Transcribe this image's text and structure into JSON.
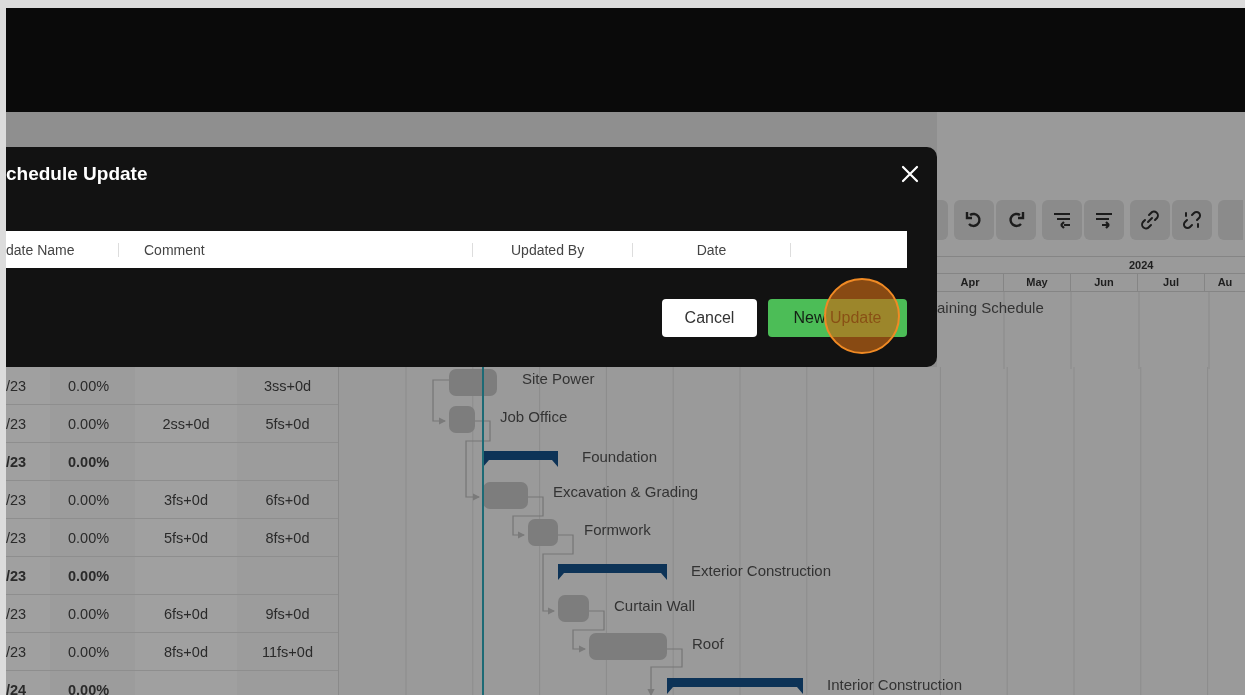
{
  "dialog": {
    "title": "chedule Update",
    "columns": [
      "date Name",
      "Comment",
      "Updated By",
      "Date"
    ],
    "buttons": [
      {
        "label": "Cancel",
        "kind": "secondary"
      },
      {
        "label": "New Update",
        "kind": "primary"
      }
    ]
  },
  "timeline": {
    "year": "2024",
    "months": [
      "Apr",
      "May",
      "Jun",
      "Jul",
      "Au"
    ]
  },
  "gantt": {
    "project_label": "aining Schedule",
    "items": [
      {
        "name": "Site Power",
        "kind": "task"
      },
      {
        "name": "Job Office",
        "kind": "task"
      },
      {
        "name": "Foundation",
        "kind": "summary"
      },
      {
        "name": "Excavation & Grading",
        "kind": "task"
      },
      {
        "name": "Formwork",
        "kind": "task"
      },
      {
        "name": "Exterior Construction",
        "kind": "summary"
      },
      {
        "name": "Curtain Wall",
        "kind": "task"
      },
      {
        "name": "Roof",
        "kind": "task"
      },
      {
        "name": "Interior Construction",
        "kind": "summary"
      }
    ]
  },
  "table": {
    "rows": [
      {
        "kind": "task",
        "date": "/23",
        "progress": "0.00%",
        "successors": "3ss+0d"
      },
      {
        "kind": "task",
        "date": "/23",
        "progress": "0.00%",
        "predecessors": "2ss+0d",
        "successors": "5fs+0d"
      },
      {
        "kind": "summary",
        "date": "/23",
        "progress": "0.00%"
      },
      {
        "kind": "task",
        "date": "/23",
        "progress": "0.00%",
        "predecessors": "3fs+0d",
        "successors": "6fs+0d"
      },
      {
        "kind": "task",
        "date": "/23",
        "progress": "0.00%",
        "predecessors": "5fs+0d",
        "successors": "8fs+0d"
      },
      {
        "kind": "summary",
        "date": "/23",
        "progress": "0.00%"
      },
      {
        "kind": "task",
        "date": "/23",
        "progress": "0.00%",
        "predecessors": "6fs+0d",
        "successors": "9fs+0d"
      },
      {
        "kind": "task",
        "date": "/23",
        "progress": "0.00%",
        "predecessors": "8fs+0d",
        "successors": "11fs+0d"
      },
      {
        "kind": "summary",
        "date": "/24",
        "progress": "0.00%"
      }
    ]
  }
}
